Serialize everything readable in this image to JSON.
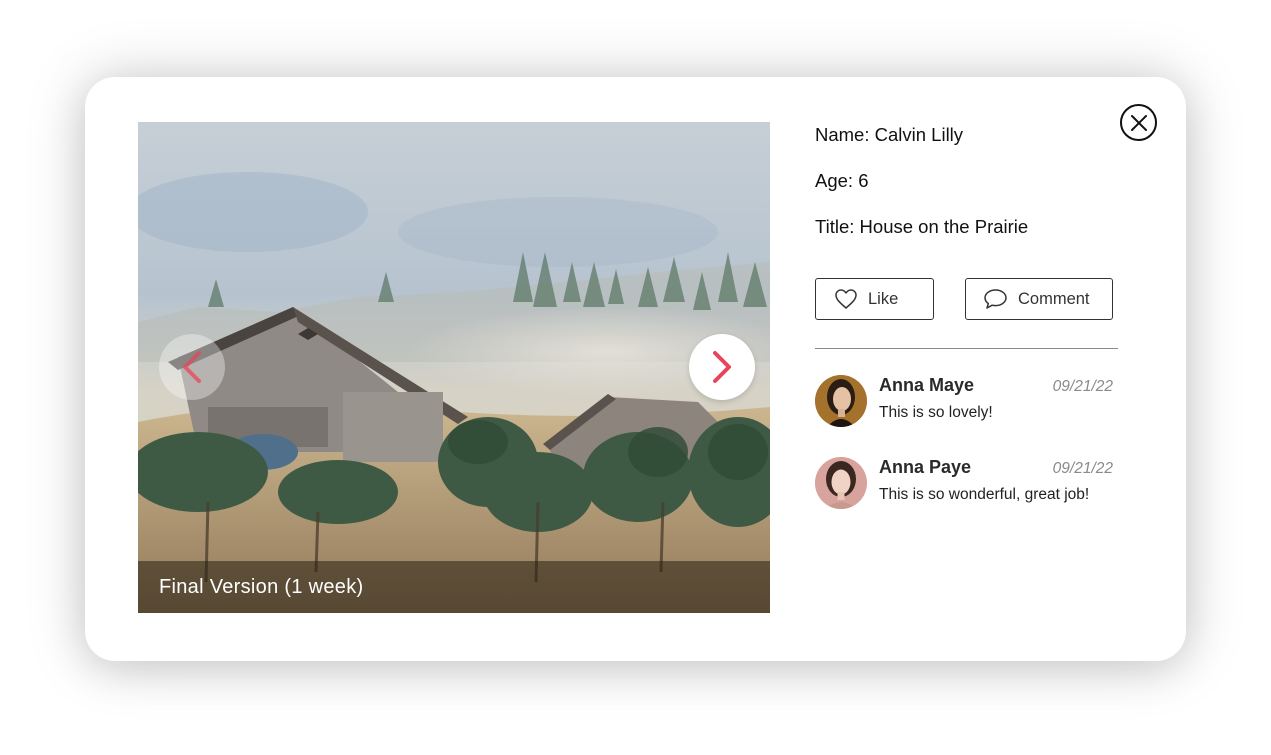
{
  "viewer": {
    "caption": "Final Version (1 week)",
    "prev_icon": "chevron-left-icon",
    "next_icon": "chevron-right-icon",
    "accent_color": "#e8455a"
  },
  "artwork": {
    "name_line": "Name: Calvin Lilly",
    "age_line": "Age: 6",
    "title_line": "Title: House on the Prairie"
  },
  "actions": {
    "like_label": "Like",
    "like_icon": "heart-icon",
    "comment_label": "Comment",
    "comment_icon": "speech-bubble-icon"
  },
  "close_icon": "close-icon",
  "comments": [
    {
      "author": "Anna Maye",
      "date": "09/21/22",
      "text": "This is so lovely!"
    },
    {
      "author": "Anna Paye",
      "date": "09/21/22",
      "text": "This is so wonderful, great job!"
    }
  ]
}
